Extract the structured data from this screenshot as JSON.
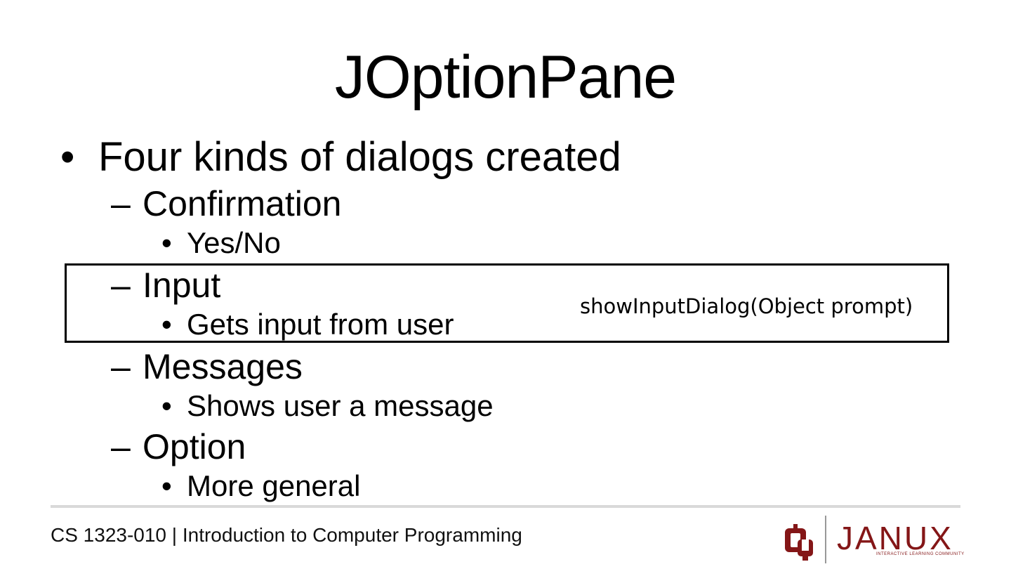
{
  "slide": {
    "title": "JOptionPane",
    "bullet": "Four kinds of dialogs created",
    "items": [
      {
        "label": "Confirmation",
        "sub": "Yes/No"
      },
      {
        "label": "Input",
        "sub": "Gets input from user"
      },
      {
        "label": "Messages",
        "sub": "Shows user a message"
      },
      {
        "label": "Option",
        "sub": "More general"
      }
    ],
    "callout": "showInputDialog(Object prompt)",
    "dash": "–",
    "dot": "•"
  },
  "footer": {
    "course": "CS 1323-010 | Introduction to Computer Programming"
  },
  "logo": {
    "brand": "JANUX",
    "tagline": "INTERACTIVE LEARNING COMMUNITY",
    "color": "#841617"
  }
}
